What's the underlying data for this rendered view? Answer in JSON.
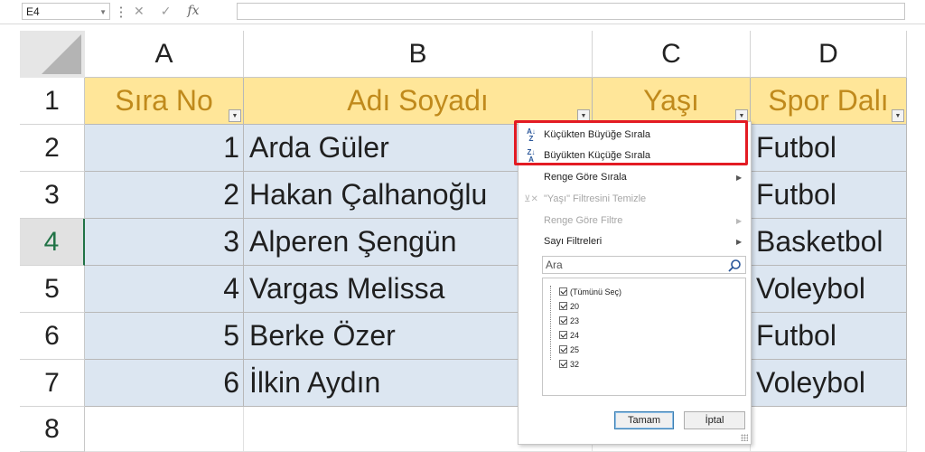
{
  "formula_bar": {
    "name_box": "E4",
    "fx_label": "fx"
  },
  "columns": [
    "A",
    "B",
    "C",
    "D"
  ],
  "rows": [
    "1",
    "2",
    "3",
    "4",
    "5",
    "6",
    "7",
    "8"
  ],
  "active_row": "4",
  "table": {
    "headers": [
      "Sıra No",
      "Adı Soyadı",
      "Yaşı",
      "Spor Dalı"
    ],
    "rows": [
      {
        "no": "1",
        "name": "Arda Güler",
        "sport": "Futbol"
      },
      {
        "no": "2",
        "name": "Hakan Çalhanoğlu",
        "sport": "Futbol"
      },
      {
        "no": "3",
        "name": "Alperen Şengün",
        "sport": "Basketbol"
      },
      {
        "no": "4",
        "name": "Vargas Melissa",
        "sport": "Voleybol"
      },
      {
        "no": "5",
        "name": "Berke Özer",
        "sport": "Futbol"
      },
      {
        "no": "6",
        "name": "İlkin Aydın",
        "sport": "Voleybol"
      }
    ]
  },
  "filter_menu": {
    "sort_asc": "Küçükten Büyüğe Sırala",
    "sort_desc": "Büyükten Küçüğe Sırala",
    "sort_by_color": "Renge Göre Sırala",
    "clear_filter": "\"Yaşı\" Filtresini Temizle",
    "filter_by_color": "Renge Göre Filtre",
    "number_filters": "Sayı Filtreleri",
    "search_placeholder": "Ara",
    "items": [
      "(Tümünü Seç)",
      "20",
      "23",
      "24",
      "25",
      "32"
    ],
    "ok": "Tamam",
    "cancel": "İptal"
  },
  "colors": {
    "header_fill": "#ffe699",
    "header_text": "#c08a1c",
    "row_fill": "#dce6f1",
    "highlight": "#e31b23"
  }
}
